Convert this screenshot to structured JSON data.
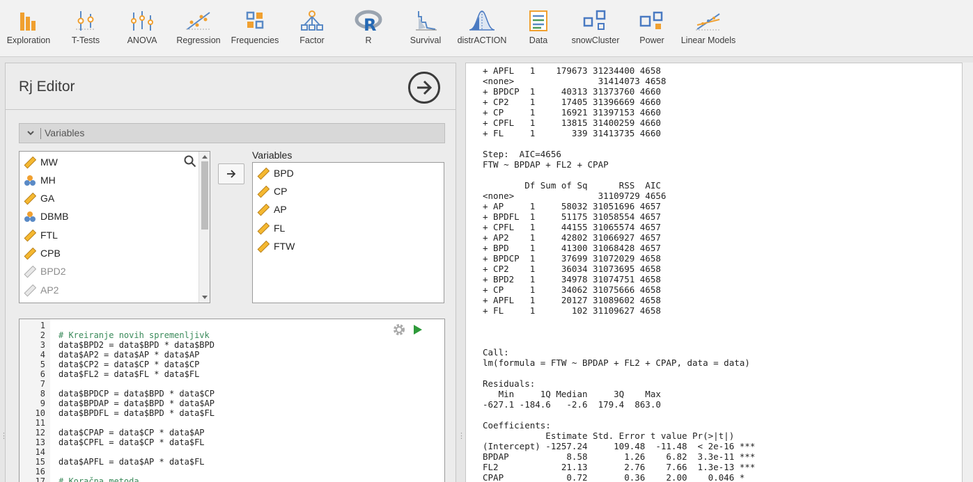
{
  "toolbar": {
    "items": [
      {
        "label": "Exploration",
        "icon": "exploration-icon"
      },
      {
        "label": "T-Tests",
        "icon": "t-tests-icon"
      },
      {
        "label": "ANOVA",
        "icon": "anova-icon"
      },
      {
        "label": "Regression",
        "icon": "regression-icon"
      },
      {
        "label": "Frequencies",
        "icon": "frequencies-icon"
      },
      {
        "label": "Factor",
        "icon": "factor-icon"
      },
      {
        "label": "R",
        "icon": "r-logo-icon"
      },
      {
        "label": "Survival",
        "icon": "survival-icon"
      },
      {
        "label": "distrACTION",
        "icon": "distribution-icon"
      },
      {
        "label": "Data",
        "icon": "data-icon"
      },
      {
        "label": "snowCluster",
        "icon": "cluster-icon"
      },
      {
        "label": "Power",
        "icon": "power-icon"
      },
      {
        "label": "Linear Models",
        "icon": "linear-models-icon"
      }
    ]
  },
  "editor": {
    "title": "Rj Editor",
    "variables_header": "Variables",
    "available_variables": [
      {
        "name": "MW",
        "type": "continuous"
      },
      {
        "name": "MH",
        "type": "nominal"
      },
      {
        "name": "GA",
        "type": "continuous"
      },
      {
        "name": "DBMB",
        "type": "nominal"
      },
      {
        "name": "FTL",
        "type": "continuous"
      },
      {
        "name": "CPB",
        "type": "continuous"
      },
      {
        "name": "BPD2",
        "type": "computed"
      },
      {
        "name": "AP2",
        "type": "computed"
      }
    ],
    "target_label": "Variables",
    "selected_variables": [
      "BPD",
      "CP",
      "AP",
      "FL",
      "FTW"
    ],
    "code_lines": [
      {
        "n": "1",
        "text": "",
        "comment": false
      },
      {
        "n": "2",
        "text": "# Kreiranje novih spremenljivk",
        "comment": true
      },
      {
        "n": "3",
        "text": "data$BPD2 = data$BPD * data$BPD",
        "comment": false
      },
      {
        "n": "4",
        "text": "data$AP2 = data$AP * data$AP",
        "comment": false
      },
      {
        "n": "5",
        "text": "data$CP2 = data$CP * data$CP",
        "comment": false
      },
      {
        "n": "6",
        "text": "data$FL2 = data$FL * data$FL",
        "comment": false
      },
      {
        "n": "7",
        "text": "",
        "comment": false
      },
      {
        "n": "8",
        "text": "data$BPDCP = data$BPD * data$CP",
        "comment": false
      },
      {
        "n": "9",
        "text": "data$BPDAP = data$BPD * data$AP",
        "comment": false
      },
      {
        "n": "10",
        "text": "data$BPDFL = data$BPD * data$FL",
        "comment": false
      },
      {
        "n": "11",
        "text": "",
        "comment": false
      },
      {
        "n": "12",
        "text": "data$CPAP = data$CP * data$AP",
        "comment": false
      },
      {
        "n": "13",
        "text": "data$CPFL = data$CP * data$FL",
        "comment": false
      },
      {
        "n": "14",
        "text": "",
        "comment": false
      },
      {
        "n": "15",
        "text": "data$APFL = data$AP * data$FL",
        "comment": false
      },
      {
        "n": "16",
        "text": "",
        "comment": false
      },
      {
        "n": "17",
        "text": "# Koračna metoda",
        "comment": true
      }
    ]
  },
  "output": {
    "lines": [
      "+ APFL   1    179673 31234400 4658",
      "<none>                31414073 4658",
      "+ BPDCP  1     40313 31373760 4660",
      "+ CP2    1     17405 31396669 4660",
      "+ CP     1     16921 31397153 4660",
      "+ CPFL   1     13815 31400259 4660",
      "+ FL     1       339 31413735 4660",
      "",
      "Step:  AIC=4656",
      "FTW ~ BPDAP + FL2 + CPAP",
      "",
      "        Df Sum of Sq      RSS  AIC",
      "<none>                31109729 4656",
      "+ AP     1     58032 31051696 4657",
      "+ BPDFL  1     51175 31058554 4657",
      "+ CPFL   1     44155 31065574 4657",
      "+ AP2    1     42802 31066927 4657",
      "+ BPD    1     41300 31068428 4657",
      "+ BPDCP  1     37699 31072029 4658",
      "+ CP2    1     36034 31073695 4658",
      "+ BPD2   1     34978 31074751 4658",
      "+ CP     1     34062 31075666 4658",
      "+ APFL   1     20127 31089602 4658",
      "+ FL     1       102 31109627 4658",
      "",
      "",
      "",
      "Call:",
      "lm(formula = FTW ~ BPDAP + FL2 + CPAP, data = data)",
      "",
      "Residuals:",
      "   Min     1Q Median     3Q    Max",
      "-627.1 -184.6   -2.6  179.4  863.0",
      "",
      "Coefficients:",
      "            Estimate Std. Error t value Pr(>|t|)",
      "(Intercept) -1257.24     109.48  -11.48  < 2e-16 ***",
      "BPDAP           8.58       1.26    6.82  3.3e-11 ***",
      "FL2            21.13       2.76    7.66  1.3e-13 ***",
      "CPAP            0.72       0.36    2.00    0.046 *"
    ]
  }
}
